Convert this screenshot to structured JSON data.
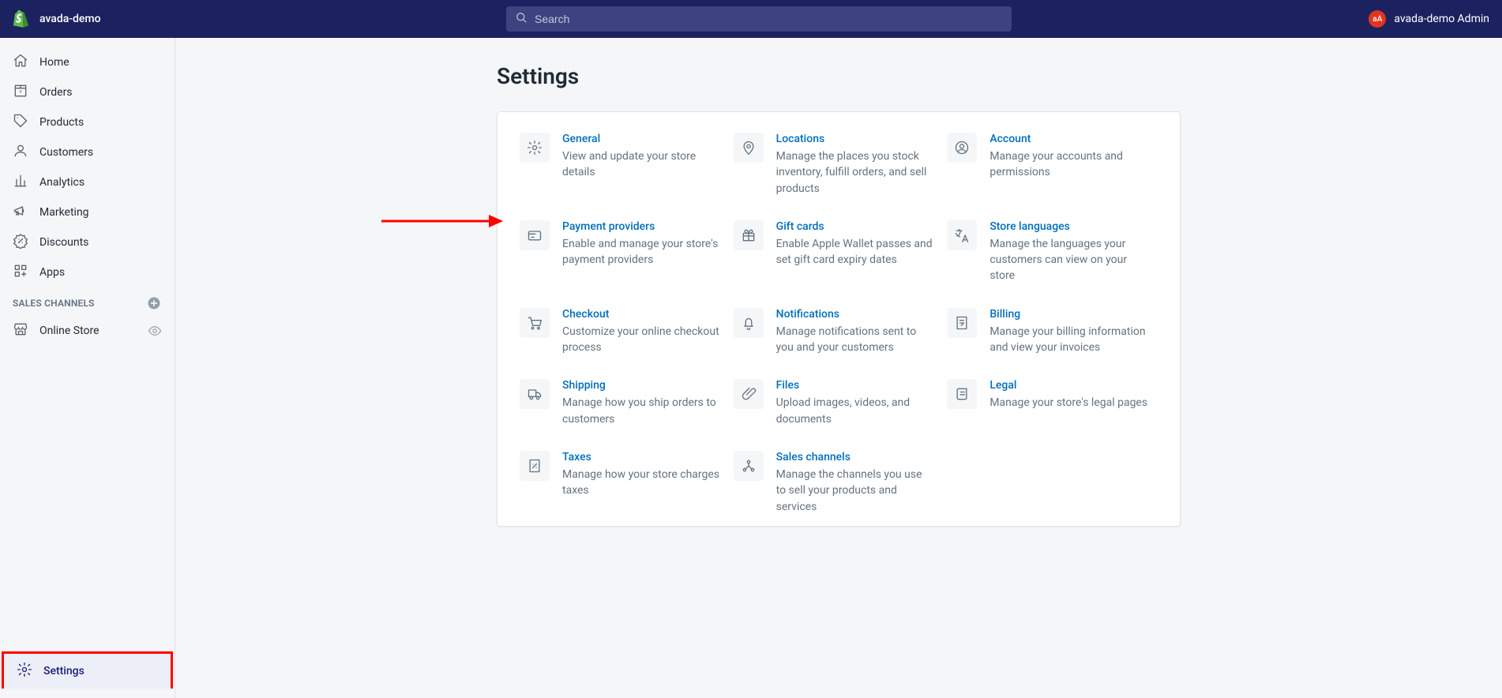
{
  "topbar": {
    "store_name": "avada-demo",
    "search_placeholder": "Search",
    "avatar_initials": "aA",
    "user_name": "avada-demo Admin"
  },
  "sidebar": {
    "nav": [
      {
        "key": "home",
        "label": "Home",
        "icon": "home-icon"
      },
      {
        "key": "orders",
        "label": "Orders",
        "icon": "orders-icon"
      },
      {
        "key": "products",
        "label": "Products",
        "icon": "tag-icon"
      },
      {
        "key": "customers",
        "label": "Customers",
        "icon": "person-icon"
      },
      {
        "key": "analytics",
        "label": "Analytics",
        "icon": "analytics-icon"
      },
      {
        "key": "marketing",
        "label": "Marketing",
        "icon": "megaphone-icon"
      },
      {
        "key": "discounts",
        "label": "Discounts",
        "icon": "discount-icon"
      },
      {
        "key": "apps",
        "label": "Apps",
        "icon": "apps-icon"
      }
    ],
    "channels_title": "SALES CHANNELS",
    "channels": [
      {
        "key": "online-store",
        "label": "Online Store"
      }
    ],
    "settings_label": "Settings"
  },
  "page": {
    "title": "Settings",
    "annotation_arrow": true
  },
  "settings_cards": [
    {
      "key": "general",
      "title": "General",
      "desc": "View and update your store details",
      "icon": "gear-icon"
    },
    {
      "key": "locations",
      "title": "Locations",
      "desc": "Manage the places you stock inventory, fulfill orders, and sell products",
      "icon": "pin-icon"
    },
    {
      "key": "account",
      "title": "Account",
      "desc": "Manage your accounts and permissions",
      "icon": "user-circle-icon"
    },
    {
      "key": "payment-providers",
      "title": "Payment providers",
      "desc": "Enable and manage your store's payment providers",
      "icon": "card-icon"
    },
    {
      "key": "gift-cards",
      "title": "Gift cards",
      "desc": "Enable Apple Wallet passes and set gift card expiry dates",
      "icon": "gift-icon"
    },
    {
      "key": "store-languages",
      "title": "Store languages",
      "desc": "Manage the languages your customers can view on your store",
      "icon": "translate-icon"
    },
    {
      "key": "checkout",
      "title": "Checkout",
      "desc": "Customize your online checkout process",
      "icon": "cart-icon"
    },
    {
      "key": "notifications",
      "title": "Notifications",
      "desc": "Manage notifications sent to you and your customers",
      "icon": "bell-icon"
    },
    {
      "key": "billing",
      "title": "Billing",
      "desc": "Manage your billing information and view your invoices",
      "icon": "receipt-icon"
    },
    {
      "key": "shipping",
      "title": "Shipping",
      "desc": "Manage how you ship orders to customers",
      "icon": "truck-icon"
    },
    {
      "key": "files",
      "title": "Files",
      "desc": "Upload images, videos, and documents",
      "icon": "clip-icon"
    },
    {
      "key": "legal",
      "title": "Legal",
      "desc": "Manage your store's legal pages",
      "icon": "scroll-icon"
    },
    {
      "key": "taxes",
      "title": "Taxes",
      "desc": "Manage how your store charges taxes",
      "icon": "percent-doc-icon"
    },
    {
      "key": "sales-channels",
      "title": "Sales channels",
      "desc": "Manage the channels you use to sell your products and services",
      "icon": "channels-icon"
    }
  ]
}
